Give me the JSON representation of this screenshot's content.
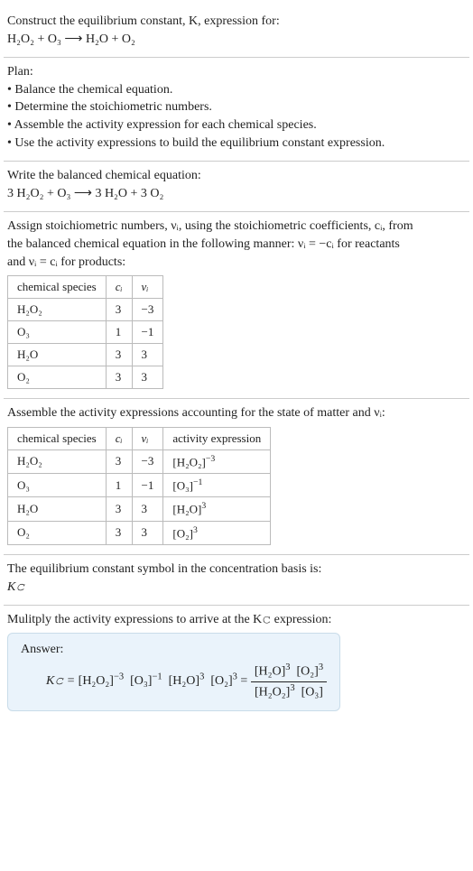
{
  "s1": {
    "l1": "Construct the equilibrium constant, K, expression for:",
    "eq": "H₂O₂ + O₃  ⟶  H₂O + O₂"
  },
  "s2": {
    "title": "Plan:",
    "b1": "• Balance the chemical equation.",
    "b2": "• Determine the stoichiometric numbers.",
    "b3": "• Assemble the activity expression for each chemical species.",
    "b4": "• Use the activity expressions to build the equilibrium constant expression."
  },
  "s3": {
    "l1": "Write the balanced chemical equation:",
    "eq": "3 H₂O₂ + O₃  ⟶  3 H₂O + 3 O₂"
  },
  "s4": {
    "intro1": "Assign stoichiometric numbers, νᵢ, using the stoichiometric coefficients, cᵢ, from",
    "intro2": "the balanced chemical equation in the following manner: νᵢ = −cᵢ for reactants",
    "intro3": "and νᵢ = cᵢ for products:",
    "h1": "chemical species",
    "h2": "cᵢ",
    "h3": "νᵢ",
    "rows": [
      {
        "sp": "H₂O₂",
        "c": "3",
        "v": "−3"
      },
      {
        "sp": "O₃",
        "c": "1",
        "v": "−1"
      },
      {
        "sp": "H₂O",
        "c": "3",
        "v": "3"
      },
      {
        "sp": "O₂",
        "c": "3",
        "v": "3"
      }
    ]
  },
  "s5": {
    "intro": "Assemble the activity expressions accounting for the state of matter and νᵢ:",
    "h1": "chemical species",
    "h2": "cᵢ",
    "h3": "νᵢ",
    "h4": "activity expression",
    "rows": [
      {
        "sp": "H₂O₂",
        "c": "3",
        "v": "−3",
        "a_base": "[H₂O₂]",
        "a_exp": "−3"
      },
      {
        "sp": "O₃",
        "c": "1",
        "v": "−1",
        "a_base": "[O₃]",
        "a_exp": "−1"
      },
      {
        "sp": "H₂O",
        "c": "3",
        "v": "3",
        "a_base": "[H₂O]",
        "a_exp": "3"
      },
      {
        "sp": "O₂",
        "c": "3",
        "v": "3",
        "a_base": "[O₂]",
        "a_exp": "3"
      }
    ]
  },
  "s6": {
    "l1": "The equilibrium constant symbol in the concentration basis is:",
    "sym": "K𝚌"
  },
  "s7": {
    "l1": "Mulitply the activity expressions to arrive at the K𝚌 expression:",
    "ans_label": "Answer:",
    "lhs": "K𝚌 = ",
    "t1b": "[H₂O₂]",
    "t1e": "−3",
    "t2b": "[O₃]",
    "t2e": "−1",
    "t3b": "[H₂O]",
    "t3e": "3",
    "t4b": "[O₂]",
    "t4e": "3",
    "eq": " = ",
    "num1b": "[H₂O]",
    "num1e": "3",
    "num2b": "[O₂]",
    "num2e": "3",
    "den1b": "[H₂O₂]",
    "den1e": "3",
    "den2b": "[O₃]",
    "den2e": ""
  },
  "chart_data": {
    "type": "table",
    "tables": [
      {
        "title": "Stoichiometric numbers",
        "columns": [
          "chemical species",
          "c_i",
          "nu_i"
        ],
        "rows": [
          [
            "H2O2",
            3,
            -3
          ],
          [
            "O3",
            1,
            -1
          ],
          [
            "H2O",
            3,
            3
          ],
          [
            "O2",
            3,
            3
          ]
        ]
      },
      {
        "title": "Activity expressions",
        "columns": [
          "chemical species",
          "c_i",
          "nu_i",
          "activity expression"
        ],
        "rows": [
          [
            "H2O2",
            3,
            -3,
            "[H2O2]^-3"
          ],
          [
            "O3",
            1,
            -1,
            "[O3]^-1"
          ],
          [
            "H2O",
            3,
            3,
            "[H2O]^3"
          ],
          [
            "O2",
            3,
            3,
            "[O2]^3"
          ]
        ]
      }
    ]
  }
}
